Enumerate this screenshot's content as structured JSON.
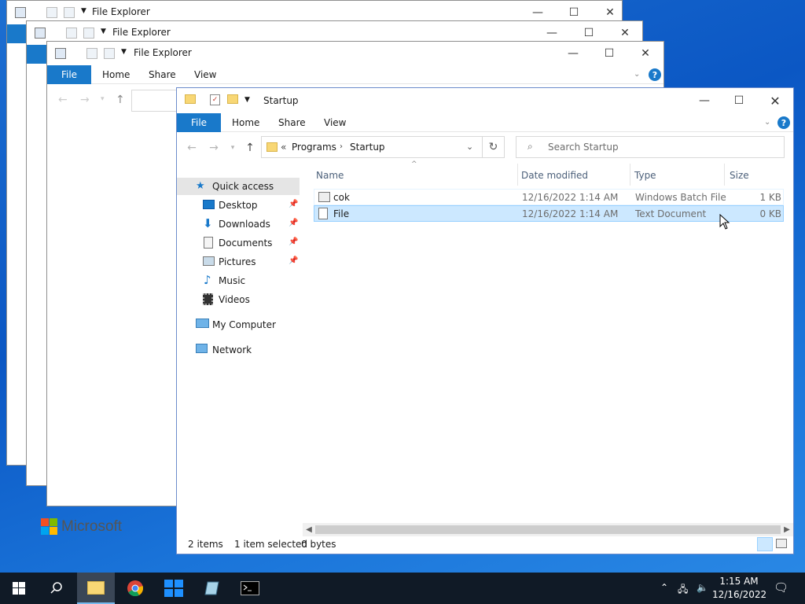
{
  "windows_bg": [
    {
      "title": "File Explorer"
    },
    {
      "title": "File Explorer"
    },
    {
      "title": "File Explorer",
      "tabs": {
        "file": "File",
        "home": "Home",
        "share": "Share",
        "view": "View"
      }
    }
  ],
  "main": {
    "title": "Startup",
    "tabs": {
      "file": "File",
      "home": "Home",
      "share": "Share",
      "view": "View"
    },
    "address": {
      "overflow": "«",
      "seg1": "Programs",
      "seg2": "Startup"
    },
    "search_placeholder": "Search Startup",
    "nav": {
      "quick_access": "Quick access",
      "desktop": "Desktop",
      "downloads": "Downloads",
      "documents": "Documents",
      "pictures": "Pictures",
      "music": "Music",
      "videos": "Videos",
      "my_computer": "My Computer",
      "network": "Network"
    },
    "columns": {
      "name": "Name",
      "date": "Date modified",
      "type": "Type",
      "size": "Size"
    },
    "files": [
      {
        "name": "cok",
        "date": "12/16/2022 1:14 AM",
        "type": "Windows Batch File",
        "size": "1 KB"
      },
      {
        "name": "File",
        "date": "12/16/2022 1:14 AM",
        "type": "Text Document",
        "size": "0 KB"
      }
    ],
    "status": {
      "items": "2 items",
      "selected": "1 item selected",
      "bytes": "0 bytes"
    }
  },
  "logo_text": "Microsoft",
  "taskbar": {
    "time": "1:15 AM",
    "date": "12/16/2022"
  },
  "colors": {
    "accent": "#1979ca",
    "selection": "#cce8ff",
    "taskbar": "#101a26"
  }
}
